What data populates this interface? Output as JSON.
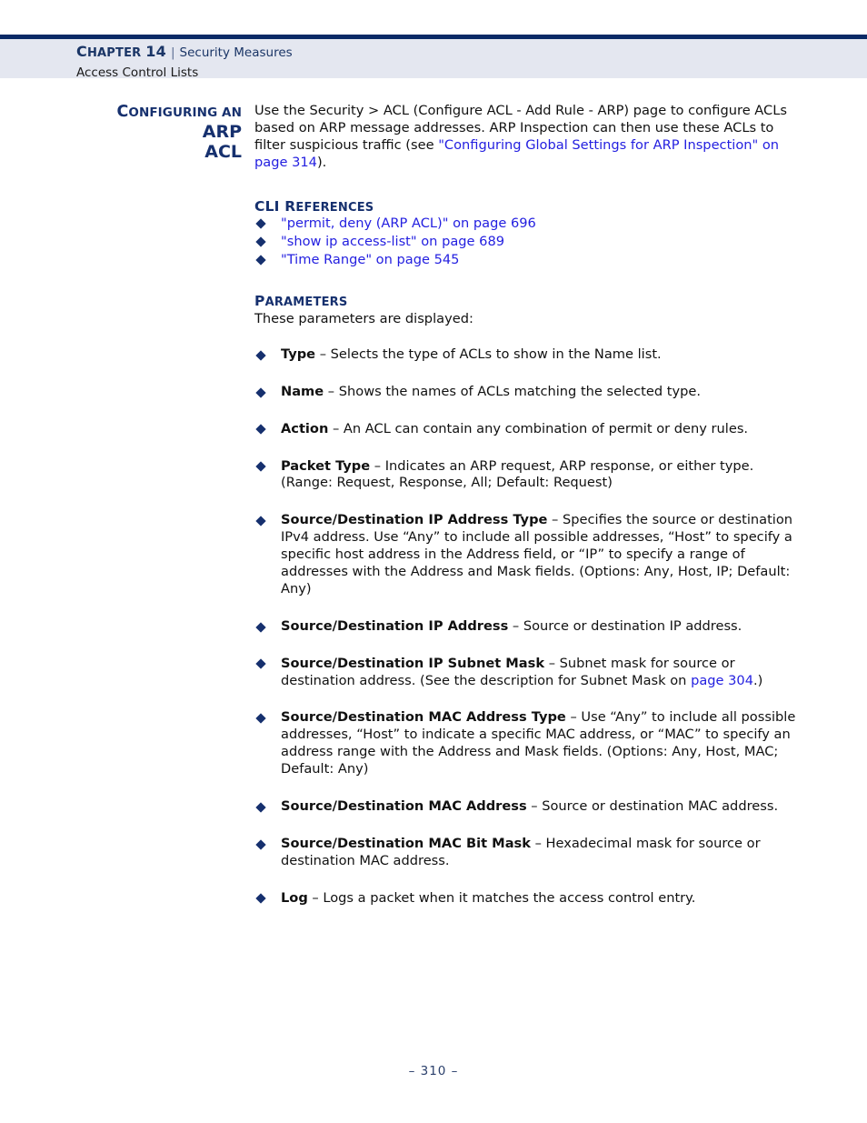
{
  "page": {
    "footer_text": "–  310  –",
    "accent_navy": "#16306e",
    "link_blue": "#2420e0",
    "header_band_bg": "#e4e7f0",
    "header_rule": "#0a2a66"
  },
  "header": {
    "chapter_label_cap": "C",
    "chapter_label_rest": "HAPTER",
    "chapter_number": "14",
    "separator": "|",
    "section_title": "Security Measures",
    "subsection_title": "Access Control Lists"
  },
  "section": {
    "heading_cap": "C",
    "heading_rest": "ONFIGURING AN",
    "heading_emphasis_line1": "ARP",
    "heading_emphasis_line2": "ACL",
    "intro_before_link": "Use the Security > ACL (Configure ACL - Add Rule - ARP) page to configure ACLs based on ARP message addresses. ARP Inspection can then use these ACLs to filter suspicious traffic (see ",
    "intro_link": "\"Configuring Global Settings for ARP Inspection\" on page 314",
    "intro_after_link": ")."
  },
  "cli_references": {
    "heading_cap": "CLI R",
    "heading_rest": "EFERENCES",
    "items": [
      "\"permit, deny (ARP ACL)\" on page 696",
      "\"show ip access-list\" on page 689",
      "\"Time Range\" on page 545"
    ]
  },
  "parameters": {
    "heading_cap": "P",
    "heading_rest": "ARAMETERS",
    "intro": "These parameters are displayed:",
    "items": [
      {
        "term": "Type",
        "desc": " – Selects the type of ACLs to show in the Name list."
      },
      {
        "term": "Name",
        "desc": " – Shows the names of ACLs matching the selected type."
      },
      {
        "term": "Action",
        "desc": " – An ACL can contain any combination of permit or deny rules."
      },
      {
        "term": "Packet Type",
        "desc": " – Indicates an ARP request, ARP response, or either type. (Range: Request, Response, All; Default: Request)"
      },
      {
        "term": "Source/Destination IP Address Type",
        "desc": " – Specifies the source or destination IPv4 address. Use “Any” to include all possible addresses, “Host” to specify a specific host address in the Address field, or “IP” to specify a range of addresses with the Address and Mask fields. (Options: Any, Host, IP; Default: Any)"
      },
      {
        "term": "Source/Destination IP Address",
        "desc": " – Source or destination IP address."
      },
      {
        "term": "Source/Destination IP Subnet Mask",
        "desc": " – Subnet mask for source or destination address. (See the description for Subnet Mask on ",
        "link": "page 304",
        "desc_after": ".)"
      },
      {
        "term": "Source/Destination MAC Address Type",
        "desc": " – Use “Any” to include all possible addresses, “Host” to indicate a specific MAC address, or “MAC” to specify an address range with the Address and Mask fields. (Options: Any, Host, MAC; Default: Any)"
      },
      {
        "term": "Source/Destination MAC Address",
        "desc": " – Source or destination MAC address."
      },
      {
        "term": "Source/Destination MAC Bit Mask",
        "desc": " – Hexadecimal mask for source or destination MAC address."
      },
      {
        "term": "Log",
        "desc": " – Logs a packet when it matches the access control entry."
      }
    ]
  }
}
